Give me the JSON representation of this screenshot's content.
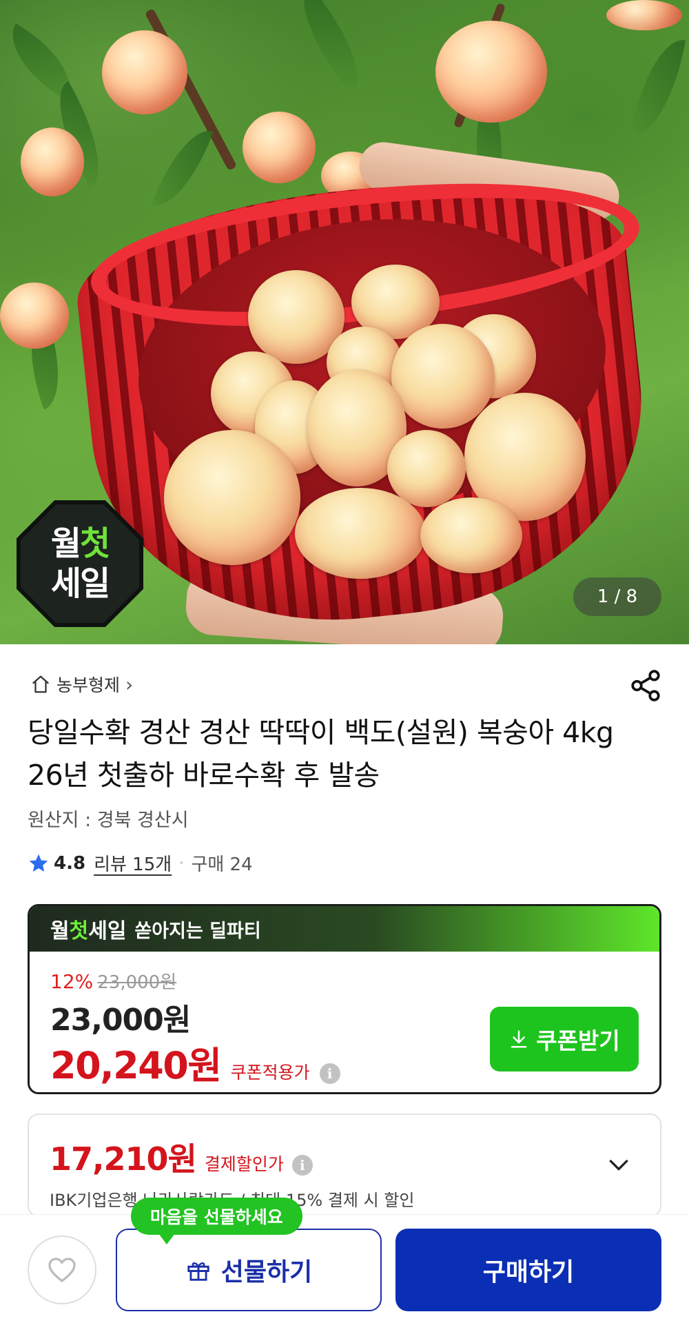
{
  "hero": {
    "counter": "1 / 8",
    "badge": {
      "line1_a": "월",
      "line1_b": "첫",
      "line2": "세일"
    }
  },
  "store": {
    "name": "농부형제",
    "chevron": "›",
    "icon": "home-icon"
  },
  "product": {
    "title": "당일수확 경산 경산 딱딱이 백도(설원) 복숭아 4kg 26년 첫출하 바로수확 후 발송",
    "origin": "원산지 : 경북 경산시",
    "rating": "4.8",
    "review_label": "리뷰 15개",
    "purchase_label": "구매 24"
  },
  "promo": {
    "brand_a": "월",
    "brand_b": "첫",
    "brand_c": "세일",
    "headline": "쏟아지는 딜파티",
    "discount_pct": "12%",
    "original_price": "23,000원",
    "price": "23,000원",
    "coupon_price": "20,240원",
    "coupon_label": "쿠폰적용가",
    "coupon_button": "쿠폰받기"
  },
  "payment": {
    "price": "17,210원",
    "label": "결제할인가",
    "description": "IBK기업은행 나라사랑카드 / 최대 15% 결제 시 할인"
  },
  "bottom": {
    "tooltip": "마음을 선물하세요",
    "gift_label": "선물하기",
    "buy_label": "구매하기"
  },
  "colors": {
    "accent_red": "#d4141c",
    "accent_green": "#1ec41e",
    "primary_blue": "#0b2fb4"
  }
}
